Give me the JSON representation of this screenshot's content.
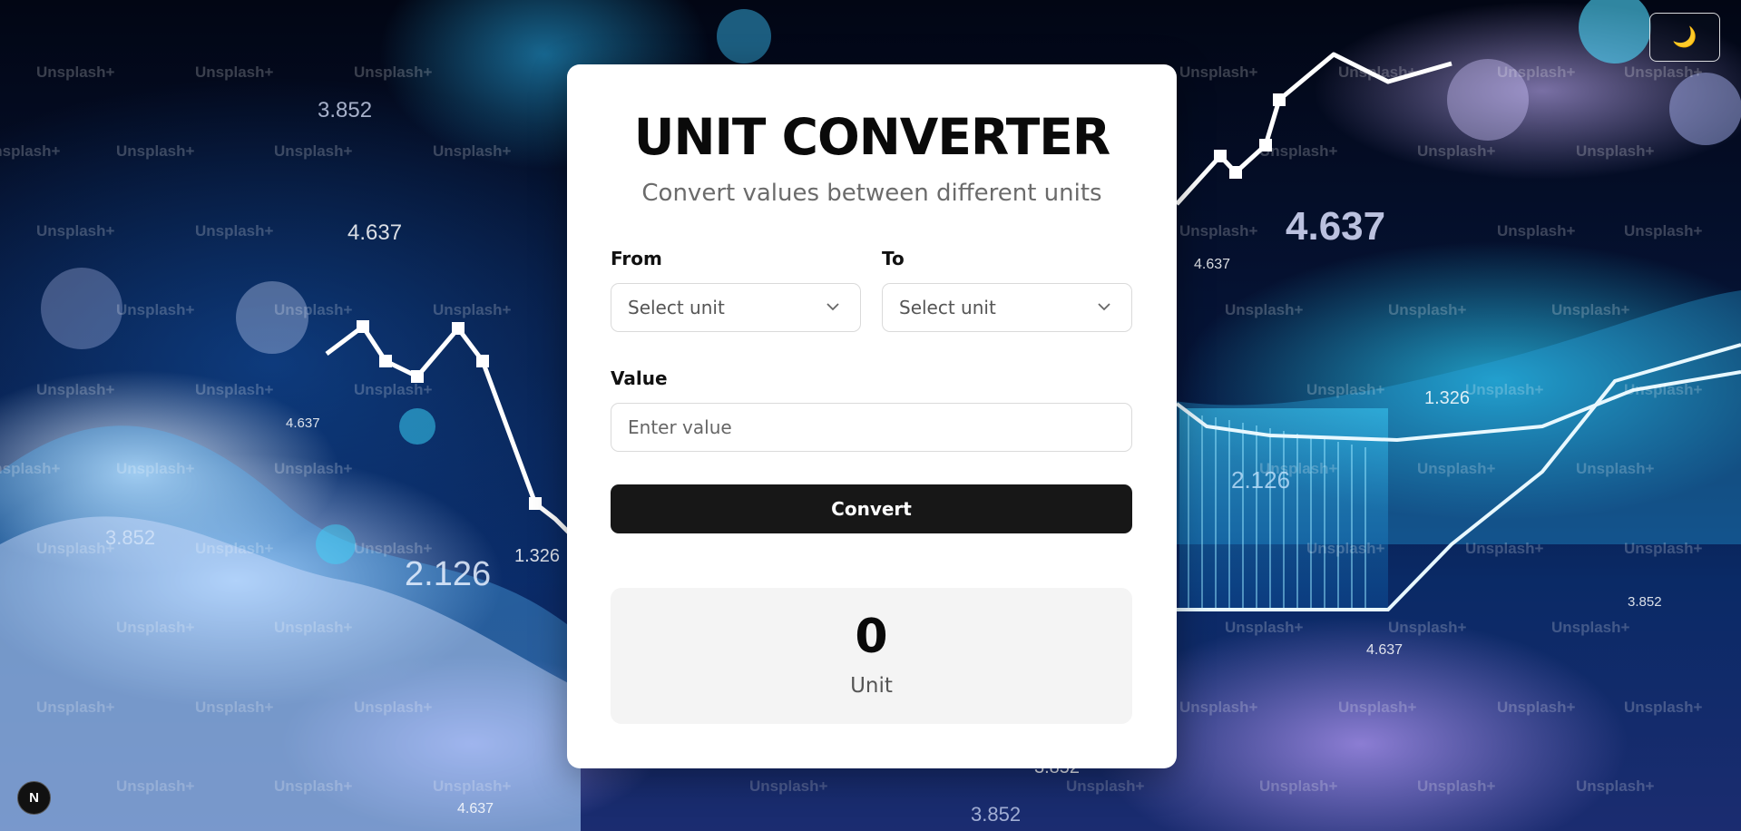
{
  "background": {
    "watermark": "Unsplash+",
    "chart_numbers": [
      "3.852",
      "4.637",
      "4.637",
      "2.126",
      "1.326",
      "3.852",
      "4.637",
      "4.637",
      "1.326",
      "2.126",
      "3.852",
      "4.637",
      "3.852",
      "3.852",
      "4.637"
    ]
  },
  "theme_toggle": {
    "icon": "moon-icon",
    "glyph": "🌙"
  },
  "next_badge": {
    "label": "N"
  },
  "converter": {
    "title": "UNIT CONVERTER",
    "subtitle": "Convert values between different units",
    "from": {
      "label": "From",
      "placeholder": "Select unit"
    },
    "to": {
      "label": "To",
      "placeholder": "Select unit"
    },
    "value": {
      "label": "Value",
      "placeholder": "Enter value",
      "current": ""
    },
    "convert_label": "Convert",
    "result": {
      "value": "0",
      "unit": "Unit"
    }
  },
  "colors": {
    "card_bg": "#ffffff",
    "button_bg": "#171717",
    "result_bg": "#f4f4f4",
    "page_bg": "#050a1e"
  }
}
